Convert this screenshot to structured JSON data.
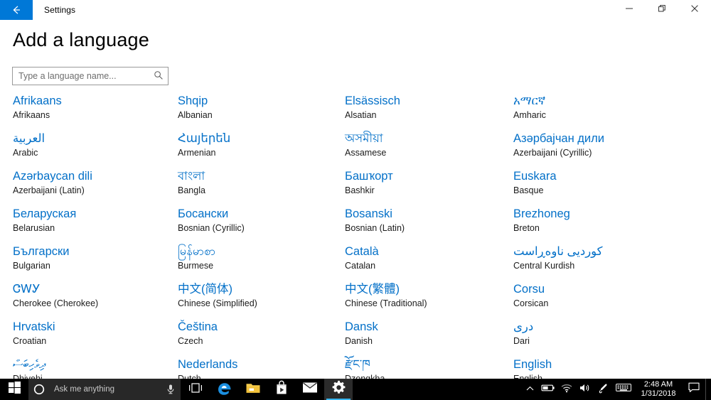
{
  "window": {
    "title": "Settings",
    "back_icon": "back-arrow-icon",
    "minimize_label": "Minimize",
    "restore_label": "Restore",
    "close_label": "Close",
    "accent_color": "#0078d7"
  },
  "page": {
    "heading": "Add a language",
    "search": {
      "placeholder": "Type a language name...",
      "value": "",
      "icon": "search-icon"
    }
  },
  "languages": [
    {
      "native": "Afrikaans",
      "english": "Afrikaans",
      "rtl": false
    },
    {
      "native": "Shqip",
      "english": "Albanian",
      "rtl": false
    },
    {
      "native": "Elsässisch",
      "english": "Alsatian",
      "rtl": false
    },
    {
      "native": "አማርኛ",
      "english": "Amharic",
      "rtl": false
    },
    {
      "native": "العربية",
      "english": "Arabic",
      "rtl": true
    },
    {
      "native": "Հայերեն",
      "english": "Armenian",
      "rtl": false
    },
    {
      "native": "অসমীয়া",
      "english": "Assamese",
      "rtl": false
    },
    {
      "native": "Азәрбајчан дили",
      "english": "Azerbaijani (Cyrillic)",
      "rtl": false
    },
    {
      "native": "Azərbaycan dili",
      "english": "Azerbaijani (Latin)",
      "rtl": false
    },
    {
      "native": "বাংলা",
      "english": "Bangla",
      "rtl": false
    },
    {
      "native": "Башҡорт",
      "english": "Bashkir",
      "rtl": false
    },
    {
      "native": "Euskara",
      "english": "Basque",
      "rtl": false
    },
    {
      "native": "Беларуская",
      "english": "Belarusian",
      "rtl": false
    },
    {
      "native": "Босански",
      "english": "Bosnian (Cyrillic)",
      "rtl": false
    },
    {
      "native": "Bosanski",
      "english": "Bosnian (Latin)",
      "rtl": false
    },
    {
      "native": "Brezhoneg",
      "english": "Breton",
      "rtl": false
    },
    {
      "native": "Български",
      "english": "Bulgarian",
      "rtl": false
    },
    {
      "native": "မြန်မာစာ",
      "english": "Burmese",
      "rtl": false
    },
    {
      "native": "Català",
      "english": "Catalan",
      "rtl": false
    },
    {
      "native": "کوردیی ناوەڕاست",
      "english": "Central Kurdish",
      "rtl": true
    },
    {
      "native": "ᏣᎳᎩ",
      "english": "Cherokee (Cherokee)",
      "rtl": false
    },
    {
      "native": "中文(简体)",
      "english": "Chinese (Simplified)",
      "rtl": false
    },
    {
      "native": "中文(繁體)",
      "english": "Chinese (Traditional)",
      "rtl": false
    },
    {
      "native": "Corsu",
      "english": "Corsican",
      "rtl": false
    },
    {
      "native": "Hrvatski",
      "english": "Croatian",
      "rtl": false
    },
    {
      "native": "Čeština",
      "english": "Czech",
      "rtl": false
    },
    {
      "native": "Dansk",
      "english": "Danish",
      "rtl": false
    },
    {
      "native": "دری",
      "english": "Dari",
      "rtl": true
    },
    {
      "native": "ދިވެހިބަސް",
      "english": "Dhivehi",
      "rtl": true
    },
    {
      "native": "Nederlands",
      "english": "Dutch",
      "rtl": false
    },
    {
      "native": "རྫོང་ཁ",
      "english": "Dzongkha",
      "rtl": false
    },
    {
      "native": "English",
      "english": "English",
      "rtl": false
    }
  ],
  "taskbar": {
    "start_icon": "windows-start-icon",
    "cortana": {
      "placeholder": "Ask me anything",
      "circle_icon": "cortana-circle-icon",
      "mic_icon": "microphone-icon"
    },
    "task_view_icon": "task-view-icon",
    "apps": [
      {
        "name": "edge-icon",
        "label": "Microsoft Edge",
        "active": false
      },
      {
        "name": "file-explorer-icon",
        "label": "File Explorer",
        "active": false
      },
      {
        "name": "microsoft-store-icon",
        "label": "Microsoft Store",
        "active": false
      },
      {
        "name": "mail-icon",
        "label": "Mail",
        "active": false
      },
      {
        "name": "settings-icon",
        "label": "Settings",
        "active": true
      }
    ],
    "tray": {
      "show_hidden_icon": "chevron-up-icon",
      "battery_icon": "battery-icon",
      "network_icon": "wifi-icon",
      "volume_icon": "speaker-icon",
      "pen_icon": "windows-ink-icon",
      "keyboard_icon": "touch-keyboard-icon",
      "time": "2:48 AM",
      "date": "1/31/2018",
      "action_center_icon": "action-center-icon"
    }
  }
}
